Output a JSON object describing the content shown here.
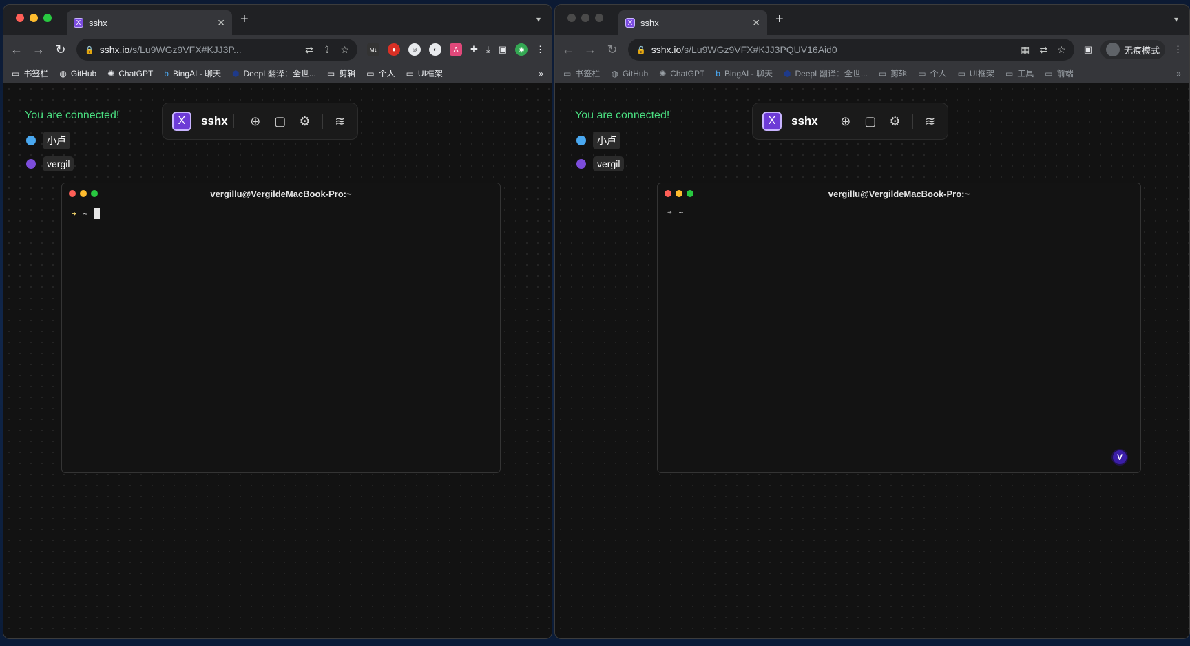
{
  "left_window": {
    "tab_title": "sshx",
    "url_host": "sshx.io",
    "url_path": "/s/Lu9WGz9VFX#KJJ3P...",
    "bookmarks": [
      "书签栏",
      "GitHub",
      "ChatGPT",
      "BingAI - 聊天",
      "DeepL翻译：全世...",
      "剪辑",
      "个人",
      "UI框架"
    ],
    "connected_text": "You are connected!",
    "users": [
      {
        "name": "小卢",
        "color": "#4aa8f0"
      },
      {
        "name": "vergil",
        "color": "#7c4ddb"
      }
    ],
    "app_name": "sshx",
    "terminal_title": "vergillu@VergildeMacBook-Pro:~",
    "prompt_arrow": "➜",
    "prompt_dir": "~"
  },
  "right_window": {
    "tab_title": "sshx",
    "url_host": "sshx.io",
    "url_path": "/s/Lu9WGz9VFX#KJJ3PQUV16Aid0",
    "incognito_label": "无痕模式",
    "bookmarks": [
      "书签栏",
      "GitHub",
      "ChatGPT",
      "BingAI - 聊天",
      "DeepL翻译：全世...",
      "剪辑",
      "个人",
      "UI框架",
      "工具",
      "前端"
    ],
    "connected_text": "You are connected!",
    "users": [
      {
        "name": "小卢",
        "color": "#4aa8f0"
      },
      {
        "name": "vergil",
        "color": "#7c4ddb"
      }
    ],
    "app_name": "sshx",
    "terminal_title": "vergillu@VergildeMacBook-Pro:~",
    "prompt_arrow": "➜",
    "prompt_dir": "~",
    "user_avatar": "V"
  },
  "icons": {
    "tab_close": "✕",
    "new_tab": "+",
    "tab_menu": "⌄",
    "bookmarks_more": "»"
  }
}
